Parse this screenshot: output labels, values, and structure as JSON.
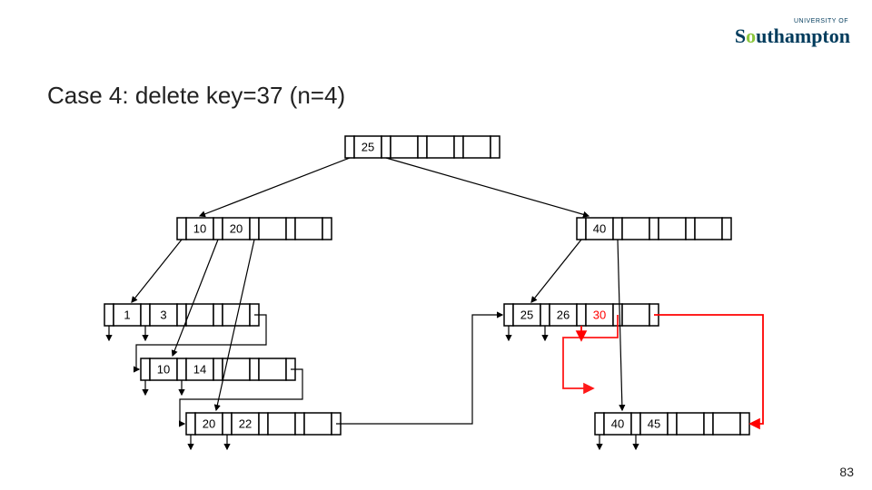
{
  "logo": {
    "small": "UNIVERSITY OF",
    "big_prefix": "S",
    "big_accent": "o",
    "big_suffix": "uthampton"
  },
  "title": "Case 4: delete key=37 (n=4)",
  "pagenum": "83",
  "nodes": {
    "root": {
      "keys": [
        "25",
        "",
        "",
        ""
      ]
    },
    "n1": {
      "keys": [
        "10",
        "20",
        "",
        ""
      ]
    },
    "n2": {
      "keys": [
        "40",
        "",
        "",
        ""
      ]
    },
    "l1": {
      "keys": [
        "1",
        "3",
        "",
        ""
      ]
    },
    "l2": {
      "keys": [
        "10",
        "14",
        "",
        ""
      ]
    },
    "l3": {
      "keys": [
        "20",
        "22",
        "",
        ""
      ]
    },
    "l4": {
      "keys": [
        "25",
        "26",
        "30",
        ""
      ]
    },
    "l5": {
      "keys": [
        "40",
        "45",
        "",
        ""
      ]
    }
  }
}
